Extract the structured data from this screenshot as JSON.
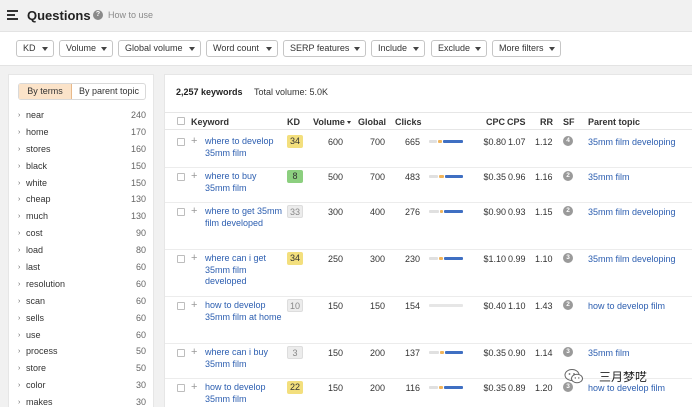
{
  "header": {
    "title": "Questions",
    "help_label": "How to use"
  },
  "filters": [
    {
      "label": "KD"
    },
    {
      "label": "Volume"
    },
    {
      "label": "Global volume"
    },
    {
      "label": "Word count"
    },
    {
      "label": "SERP features"
    },
    {
      "label": "Include"
    },
    {
      "label": "Exclude"
    },
    {
      "label": "More filters"
    }
  ],
  "terms_panel": {
    "tabs": [
      "By terms",
      "By parent topic"
    ],
    "items": [
      {
        "label": "near",
        "count": "240"
      },
      {
        "label": "home",
        "count": "170"
      },
      {
        "label": "stores",
        "count": "160"
      },
      {
        "label": "black",
        "count": "150"
      },
      {
        "label": "white",
        "count": "150"
      },
      {
        "label": "cheap",
        "count": "130"
      },
      {
        "label": "much",
        "count": "130"
      },
      {
        "label": "cost",
        "count": "90"
      },
      {
        "label": "load",
        "count": "80"
      },
      {
        "label": "last",
        "count": "60"
      },
      {
        "label": "resolution",
        "count": "60"
      },
      {
        "label": "scan",
        "count": "60"
      },
      {
        "label": "sells",
        "count": "60"
      },
      {
        "label": "use",
        "count": "60"
      },
      {
        "label": "process",
        "count": "50"
      },
      {
        "label": "store",
        "count": "50"
      },
      {
        "label": "color",
        "count": "30"
      },
      {
        "label": "makes",
        "count": "30"
      }
    ]
  },
  "summary": {
    "keywords": "2,257 keywords",
    "volume": "Total volume: 5.0K"
  },
  "table": {
    "columns": {
      "keyword": "Keyword",
      "kd": "KD",
      "volume": "Volume",
      "global": "Global",
      "clicks": "Clicks",
      "cpc": "CPC",
      "cps": "CPS",
      "rr": "RR",
      "sf": "SF",
      "parent": "Parent topic"
    },
    "rows": [
      {
        "keyword": "where to develop 35mm film",
        "kd": "34",
        "kd_color": "yellow",
        "volume": "600",
        "global": "700",
        "clicks": "665",
        "cpc": "$0.80",
        "cps": "1.07",
        "rr": "1.12",
        "sf": "4",
        "parent": "35mm film developing"
      },
      {
        "keyword": "where to buy 35mm film",
        "kd": "8",
        "kd_color": "green",
        "volume": "500",
        "global": "700",
        "clicks": "483",
        "cpc": "$0.35",
        "cps": "0.96",
        "rr": "1.16",
        "sf": "2",
        "parent": "35mm film"
      },
      {
        "keyword": "where to get 35mm film developed",
        "kd": "33",
        "kd_color": "gray",
        "volume": "300",
        "global": "400",
        "clicks": "276",
        "cpc": "$0.90",
        "cps": "0.93",
        "rr": "1.15",
        "sf": "2",
        "parent": "35mm film developing"
      },
      {
        "keyword": "where can i get 35mm film developed",
        "kd": "34",
        "kd_color": "yellow",
        "volume": "250",
        "global": "300",
        "clicks": "230",
        "cpc": "$1.10",
        "cps": "0.99",
        "rr": "1.10",
        "sf": "3",
        "parent": "35mm film developing"
      },
      {
        "keyword": "how to develop 35mm film at home",
        "kd": "10",
        "kd_color": "gray",
        "volume": "150",
        "global": "150",
        "clicks": "154",
        "cpc": "$0.40",
        "cps": "1.10",
        "rr": "1.43",
        "sf": "2",
        "parent": "how to develop film"
      },
      {
        "keyword": "where can i buy 35mm film",
        "kd": "3",
        "kd_color": "gray",
        "volume": "150",
        "global": "200",
        "clicks": "137",
        "cpc": "$0.35",
        "cps": "0.90",
        "rr": "1.14",
        "sf": "3",
        "parent": "35mm film"
      },
      {
        "keyword": "how to develop 35mm film",
        "kd": "22",
        "kd_color": "yellow",
        "volume": "150",
        "global": "200",
        "clicks": "116",
        "cpc": "$0.35",
        "cps": "0.89",
        "rr": "1.20",
        "sf": "3",
        "parent": "how to develop film"
      }
    ]
  },
  "watermark": {
    "text": "三月梦呓"
  },
  "colors": {
    "link": "#2c5eb0",
    "kd_yellow": "#f3df7d",
    "kd_green": "#8ccf7f",
    "active_tab": "#fbe3c9",
    "spark_blue": "#3f6fc2",
    "spark_orange": "#f0b45a"
  }
}
